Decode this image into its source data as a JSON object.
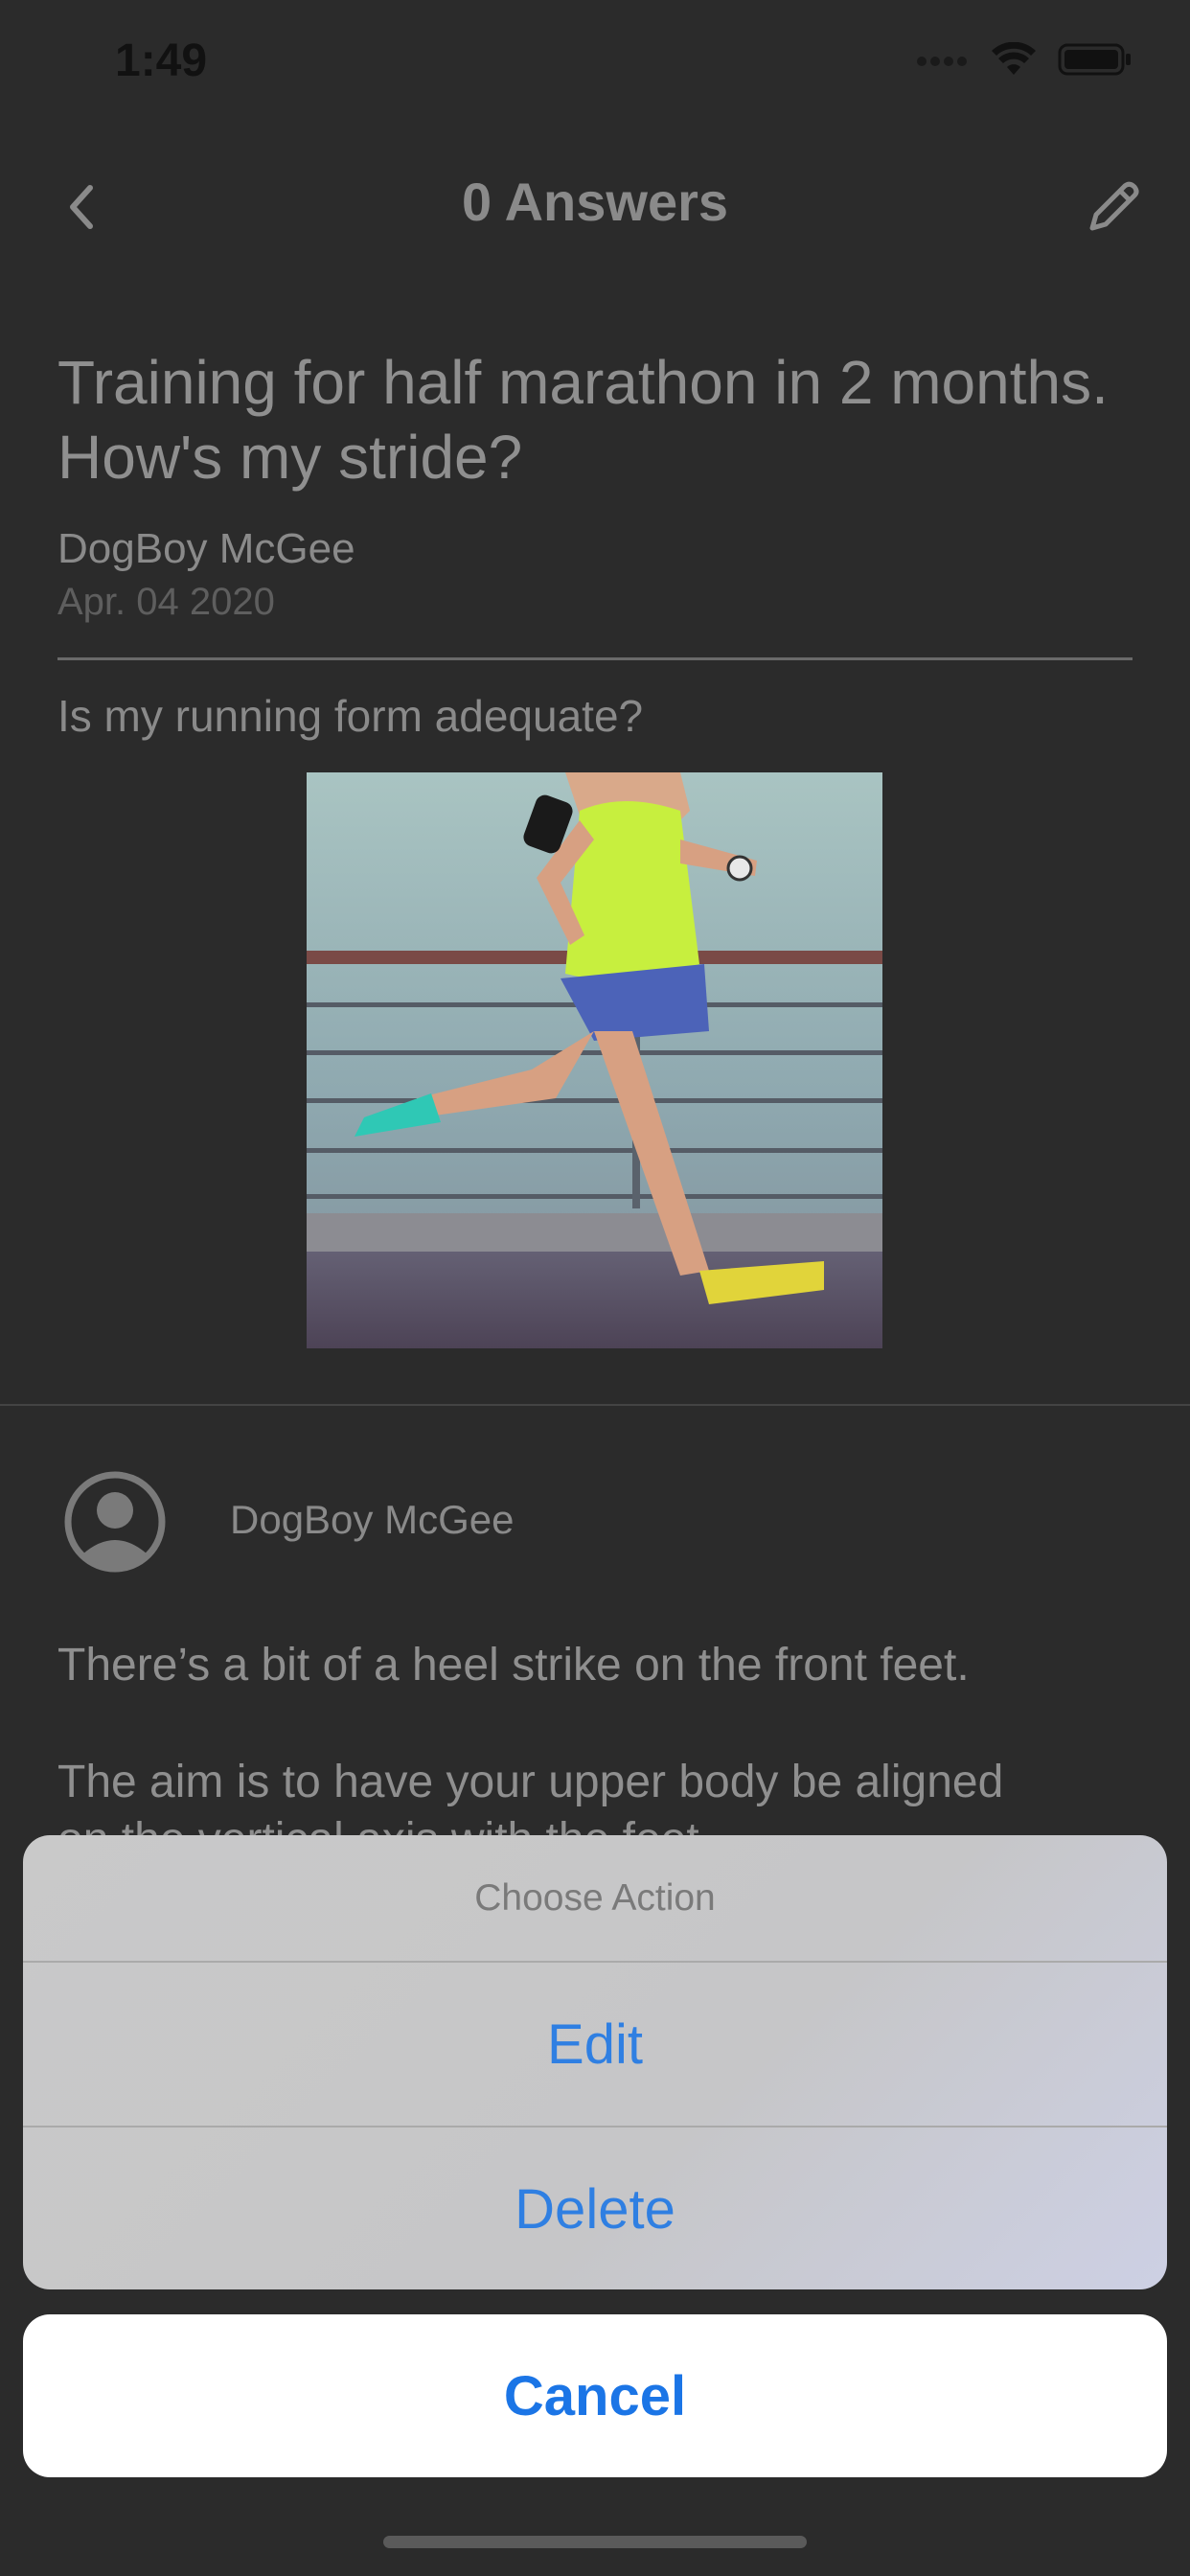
{
  "status_bar": {
    "time": "1:49"
  },
  "nav": {
    "title": "0 Answers",
    "back_icon": "chevron-left-icon",
    "edit_icon": "pencil-icon"
  },
  "question": {
    "title": "Training for half marathon in 2 months. How's my stride?",
    "author": "DogBoy McGee",
    "date": "Apr. 04 2020",
    "body": "Is my running form adequate?"
  },
  "answer": {
    "author": "DogBoy McGee",
    "line1": "There’s a bit of a heel strike on the front feet.",
    "line2": "The aim is to have your upper body be aligned",
    "line3": "on the vertical axis with the feet"
  },
  "action_sheet": {
    "title": "Choose Action",
    "edit_label": "Edit",
    "delete_label": "Delete",
    "cancel_label": "Cancel"
  },
  "colors": {
    "accent": "#1b75e6",
    "background": "#2b2b2b"
  }
}
